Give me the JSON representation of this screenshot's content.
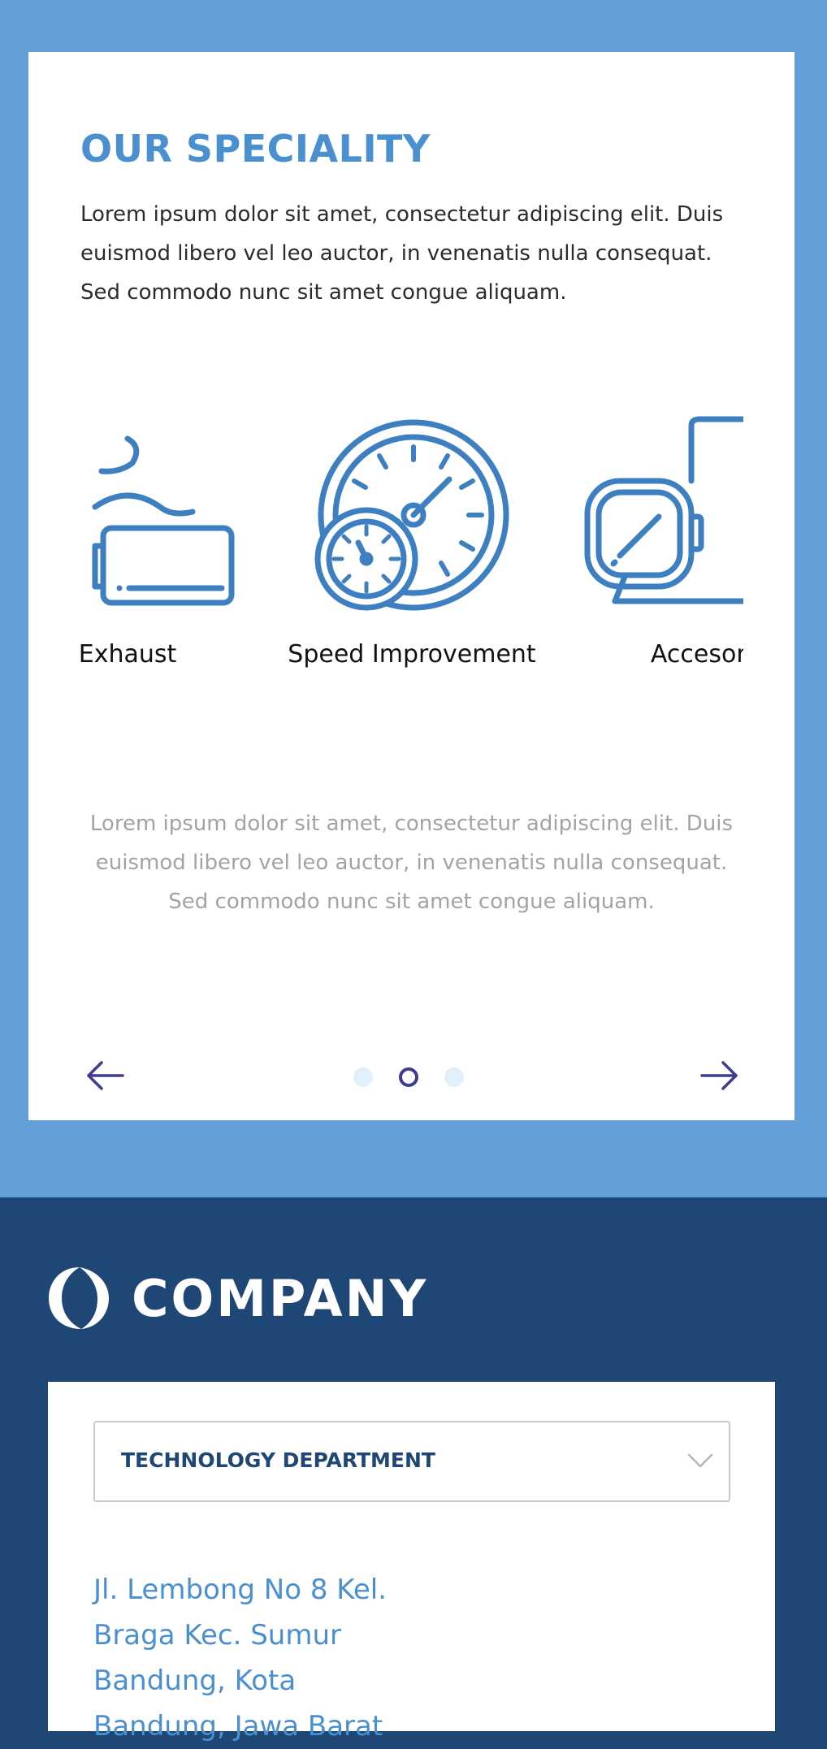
{
  "speciality": {
    "title": "OUR SPECIALITY",
    "intro": "Lorem ipsum dolor sit amet, consectetur adipiscing elit. Duis euismod libero vel leo auctor, in venenatis nulla consequat. Sed commodo nunc sit amet congue aliquam.",
    "slides": [
      {
        "label": "Exhaust",
        "icon": "exhaust-icon"
      },
      {
        "label": "Speed Improvement",
        "icon": "speedometer-icon"
      },
      {
        "label": "Accesories",
        "icon": "side-mirror-icon"
      }
    ],
    "caption": "Lorem ipsum dolor sit amet, consectetur adipiscing elit. Duis euismod libero vel leo auctor, in venenatis nulla consequat. Sed commodo nunc sit amet congue aliquam.",
    "prev_icon": "arrow-left-icon",
    "next_icon": "arrow-right-icon",
    "dots_count": 3,
    "active_dot": 2
  },
  "footer": {
    "logo_text": "COMPANY",
    "department": {
      "selected": "TECHNOLOGY DEPARTMENT",
      "icon": "chevron-down-icon"
    },
    "address_lines": [
      "Jl. Lembong No 8 Kel.",
      "Braga Kec. Sumur",
      "Bandung, Kota",
      "Bandung, Jawa Barat"
    ]
  },
  "colors": {
    "page_background": "#649fd9",
    "footer_background": "#1f4776",
    "accent": "#4a90d1",
    "icon_stroke": "#3d7fc1",
    "nav_arrow": "#3d3d8f"
  }
}
